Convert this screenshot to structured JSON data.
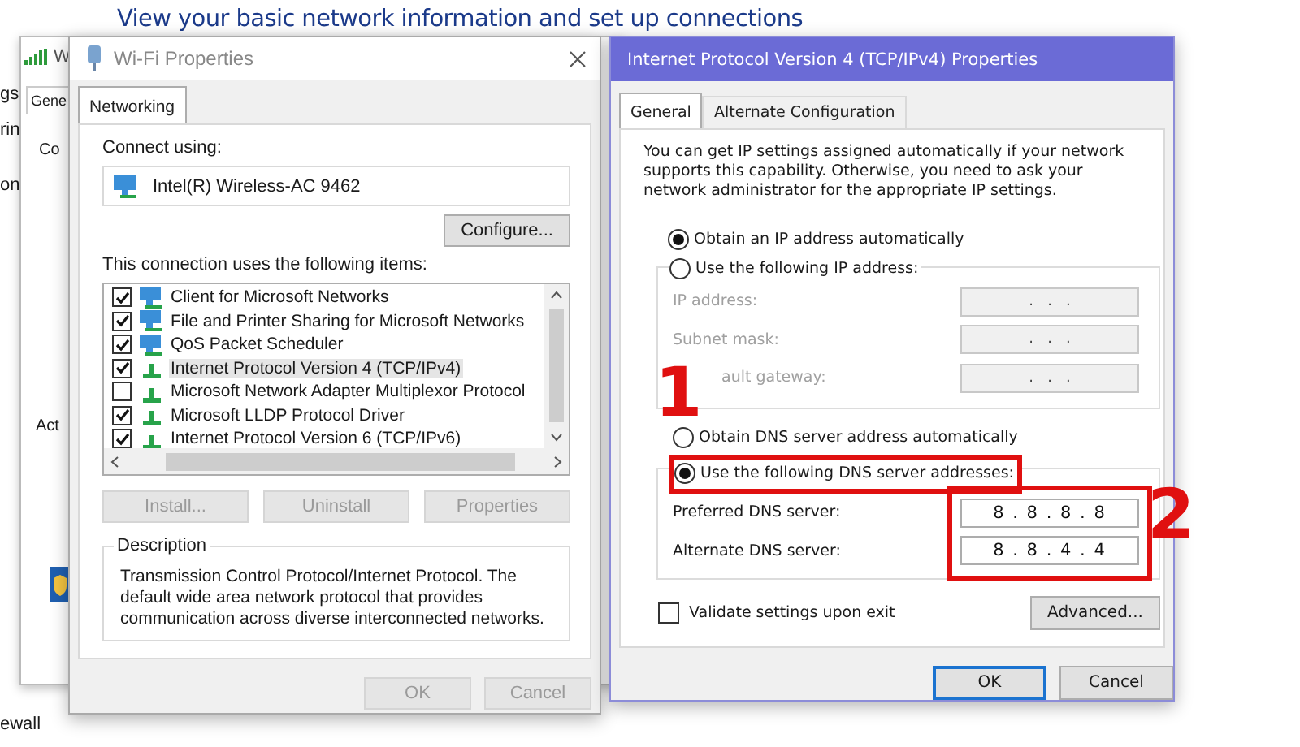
{
  "background": {
    "heading": "View your basic network information and set up connections",
    "fragments": [
      "gs",
      "rin",
      "on",
      "ewall"
    ]
  },
  "status_window": {
    "title": "W",
    "tab": "Gene",
    "labels": [
      "Co",
      "Act"
    ]
  },
  "wifi_properties": {
    "title": "Wi-Fi Properties",
    "tabs": [
      {
        "label": "Networking",
        "selected": true
      }
    ],
    "connect_using_label": "Connect using:",
    "adapter": "Intel(R) Wireless-AC 9462",
    "configure_button": "Configure...",
    "items_label": "This connection uses the following items:",
    "items": [
      {
        "label": "Client for Microsoft Networks",
        "checked": true,
        "selected": false,
        "kind": "client"
      },
      {
        "label": "File and Printer Sharing for Microsoft Networks",
        "checked": true,
        "selected": false,
        "kind": "client"
      },
      {
        "label": "QoS Packet Scheduler",
        "checked": true,
        "selected": false,
        "kind": "client"
      },
      {
        "label": "Internet Protocol Version 4 (TCP/IPv4)",
        "checked": true,
        "selected": true,
        "kind": "protocol"
      },
      {
        "label": "Microsoft Network Adapter Multiplexor Protocol",
        "checked": false,
        "selected": false,
        "kind": "protocol"
      },
      {
        "label": "Microsoft LLDP Protocol Driver",
        "checked": true,
        "selected": false,
        "kind": "protocol"
      },
      {
        "label": "Internet Protocol Version 6 (TCP/IPv6)",
        "checked": true,
        "selected": false,
        "kind": "protocol"
      }
    ],
    "buttons": [
      {
        "label": "Install...",
        "disabled": true
      },
      {
        "label": "Uninstall",
        "disabled": true
      },
      {
        "label": "Properties",
        "disabled": true
      }
    ],
    "description": {
      "title": "Description",
      "text": "Transmission Control Protocol/Internet Protocol. The default wide area network protocol that provides communication across diverse interconnected networks."
    },
    "footer_buttons": [
      {
        "label": "OK",
        "disabled": true
      },
      {
        "label": "Cancel",
        "disabled": true
      }
    ]
  },
  "ipv4_properties": {
    "title": "Internet Protocol Version 4 (TCP/IPv4) Properties",
    "tabs": [
      {
        "label": "General",
        "selected": true
      },
      {
        "label": "Alternate Configuration",
        "selected": false
      }
    ],
    "intro": "You can get IP settings assigned automatically if your network supports this capability. Otherwise, you need to ask your network administrator for the appropriate IP settings.",
    "ip_options": [
      {
        "label": "Obtain an IP address automatically",
        "selected": true
      },
      {
        "label": "Use the following IP address:",
        "selected": false
      }
    ],
    "ip_fields": [
      {
        "label": "IP address:",
        "value": ".   .   .",
        "disabled": true
      },
      {
        "label": "Subnet mask:",
        "value": ".   .   .",
        "disabled": true
      },
      {
        "label": "ault gateway:",
        "value": ".   .   .",
        "disabled": true
      }
    ],
    "dns_options": [
      {
        "label": "Obtain DNS server address automatically",
        "selected": false,
        "highlighted": false
      },
      {
        "label": "Use the following DNS server addresses:",
        "selected": true,
        "highlighted": true
      }
    ],
    "dns_fields_highlighted": true,
    "dns_fields": [
      {
        "label": "Preferred DNS server:",
        "value": "8 . 8 . 8 . 8",
        "disabled": false
      },
      {
        "label": "Alternate DNS server:",
        "value": "8 . 8 . 4 . 4",
        "disabled": false
      }
    ],
    "validate": {
      "label": "Validate settings upon exit",
      "checked": false
    },
    "advanced_button": "Advanced...",
    "footer_buttons": [
      {
        "label": "OK",
        "default": true
      },
      {
        "label": "Cancel",
        "default": false
      }
    ]
  },
  "annotations": [
    {
      "label": "1"
    },
    {
      "label": "2"
    }
  ]
}
